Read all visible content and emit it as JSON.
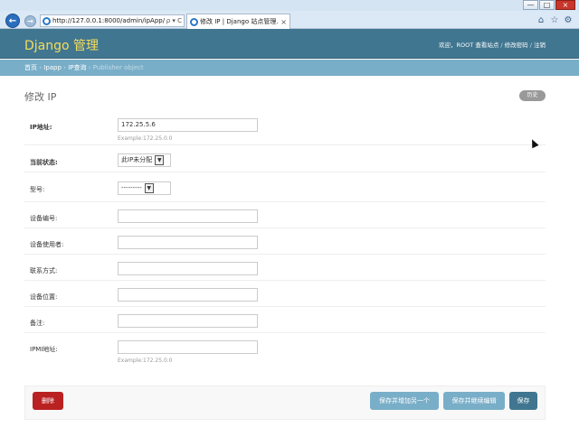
{
  "browser": {
    "url": "http://127.0.0.1:8000/admin/ipApp/",
    "url_tools": "ρ ▾ C",
    "tab_title": "修改 IP | Django 站点管理...",
    "tab_close": "×",
    "window_buttons": [
      "—",
      "□",
      "×"
    ]
  },
  "header": {
    "brand": "Django 管理",
    "welcome": "欢迎，",
    "user": "ROOT",
    "view_site": "查看站点",
    "change_password": "修改密码",
    "logout": "注销",
    "separator": " / "
  },
  "breadcrumbs": {
    "home": "首页",
    "app": "Ipapp",
    "model": "IP查询",
    "current": "Publisher object",
    "separator": " › "
  },
  "page": {
    "title": "修改 IP",
    "history_label": "历史"
  },
  "form": {
    "ip_label": "IP地址:",
    "ip_value": "172.25.5.6",
    "ip_help": "Example:172.25.0.0",
    "status_label": "当前状态:",
    "status_value": "此IP未分配",
    "type_label": "型号:",
    "type_value": "---------",
    "device_no_label": "设备编号:",
    "device_no_value": "",
    "device_user_label": "设备使用者:",
    "device_user_value": "",
    "contact_label": "联系方式:",
    "contact_value": "",
    "location_label": "设备位置:",
    "location_value": "",
    "note_label": "备注:",
    "note_value": "",
    "ipmi_label": "IPMI地址:",
    "ipmi_value": "",
    "ipmi_help": "Example:172.25.0.0"
  },
  "submit": {
    "delete": "删除",
    "save_add_another": "保存并增加另一个",
    "save_continue": "保存并继续编辑",
    "save": "保存"
  },
  "colors": {
    "header": "#417690",
    "brand": "#f5dd5d",
    "breadcrumbs": "#79aec8",
    "delete": "#ba2121"
  }
}
